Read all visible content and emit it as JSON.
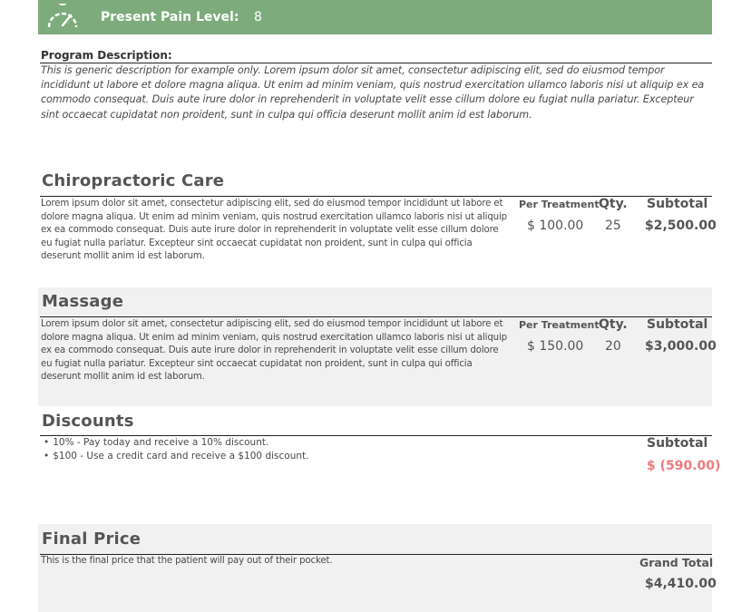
{
  "header": {
    "icon": "gauge-icon",
    "pain_label": "Present Pain Level:",
    "pain_value": "8",
    "accent_color": "#7eab7c"
  },
  "program": {
    "title": "Program Description:",
    "description": "This is generic description for example only. Lorem ipsum dolor sit amet, consectetur adipiscing elit, sed do eiusmod tempor incididunt ut labore et dolore magna aliqua. Ut enim ad minim veniam, quis nostrud exercitation ullamco laboris nisi ut aliquip ex ea commodo consequat. Duis aute irure dolor in reprehenderit in voluptate velit esse cillum dolore eu fugiat nulla pariatur. Excepteur sint occaecat cupidatat non proident, sunt in culpa qui officia deserunt mollit anim id est laborum."
  },
  "services": [
    {
      "title": "Chiropractoric Care",
      "description": "Lorem ipsum dolor sit amet, consectetur adipiscing elit, sed do eiusmod tempor incididunt ut labore et dolore magna aliqua. Ut enim ad minim veniam, quis nostrud exercitation ullamco laboris nisi ut aliquip ex ea commodo consequat. Duis aute irure dolor in reprehenderit in voluptate velit esse cillum dolore eu fugiat nulla pariatur. Excepteur sint occaecat cupidatat non proident, sunt in culpa qui officia deserunt mollit anim id est laborum.",
      "per_treatment_label": "Per Treatment",
      "qty_label": "Qty.",
      "subtotal_label": "Subtotal",
      "per_treatment": "$ 100.00",
      "qty": "25",
      "subtotal": "$2,500.00"
    },
    {
      "title": "Massage",
      "description": "Lorem ipsum dolor sit amet, consectetur adipiscing elit, sed do eiusmod tempor incididunt ut labore et dolore magna aliqua. Ut enim ad minim veniam, quis nostrud exercitation ullamco laboris nisi ut aliquip ex ea commodo consequat. Duis aute irure dolor in reprehenderit in voluptate velit esse cillum dolore eu fugiat nulla pariatur. Excepteur sint occaecat cupidatat non proident, sunt in culpa qui officia deserunt mollit anim id est laborum.",
      "per_treatment_label": "Per Treatment",
      "qty_label": "Qty.",
      "subtotal_label": "Subtotal",
      "per_treatment": "$ 150.00",
      "qty": "20",
      "subtotal": "$3,000.00"
    }
  ],
  "discounts": {
    "title": "Discounts",
    "items": [
      "10% - Pay today and receive a 10% discount.",
      "$100 - Use a credit card and receive a $100 discount."
    ],
    "subtotal_label": "Subtotal",
    "subtotal": "$ (590.00)",
    "negative_color": "#ee7b7b"
  },
  "final": {
    "title": "Final Price",
    "description": "This is the final price that the patient will pay out of their pocket.",
    "grand_total_label": "Grand Total",
    "grand_total": "$4,410.00"
  }
}
